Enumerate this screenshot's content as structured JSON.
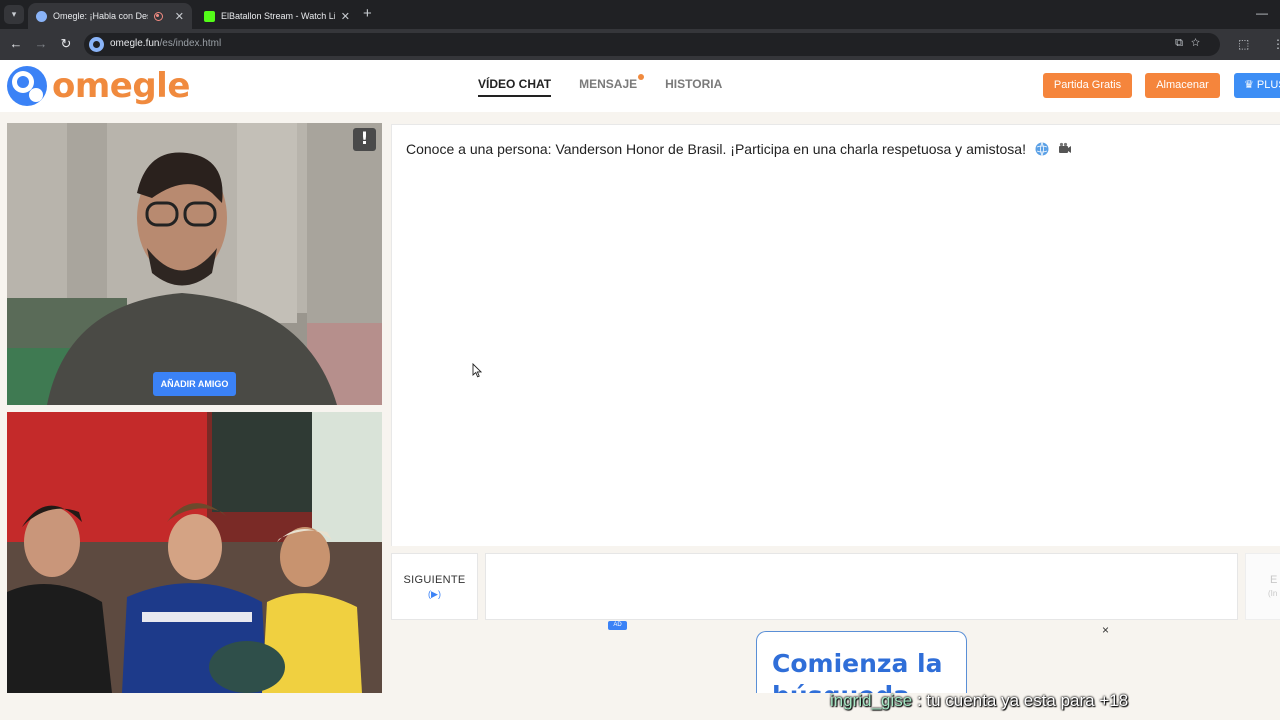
{
  "browser": {
    "tabs": [
      {
        "title": "Omegle: ¡Habla con Desconocidos!",
        "active": true,
        "favicon": "globe-icon",
        "recording": true
      },
      {
        "title": "ElBatallon Stream - Watch Live on Kick",
        "active": false,
        "favicon": "kick-icon"
      }
    ],
    "url_host": "omegle.fun",
    "url_path": "/es/index.html"
  },
  "header": {
    "logo_text": "omegle",
    "nav": [
      {
        "label": "VÍDEO CHAT",
        "active": true
      },
      {
        "label": "MENSAJE",
        "active": false,
        "notification": true
      },
      {
        "label": "HISTORIA",
        "active": false
      }
    ],
    "buttons": {
      "free_match": "Partida Gratis",
      "store": "Almacenar",
      "plus": "PLUS"
    },
    "colors": {
      "brand_orange": "#f08a3e",
      "brand_blue": "#3b82f6"
    }
  },
  "video": {
    "report_label": "!",
    "add_friend_label": "AÑADIR AMIGO"
  },
  "chat": {
    "message": "Conoce a una persona: Vanderson Honor de Brasil. ¡Participa en una charla respetuosa y amistosa!",
    "message_icons": [
      "globe-icon",
      "video-camera-icon"
    ]
  },
  "controls": {
    "next_label": "SIGUIENTE",
    "next_hint": "(▶)",
    "send_label": "E",
    "send_hint": "(In"
  },
  "ad": {
    "badge": "AD",
    "close": "×",
    "title_line1": "Comienza la",
    "title_line2": "búsqueda"
  },
  "stream_overlay": {
    "username": "ingrid_gise",
    "message": " : tu cuenta ya esta para +18"
  }
}
